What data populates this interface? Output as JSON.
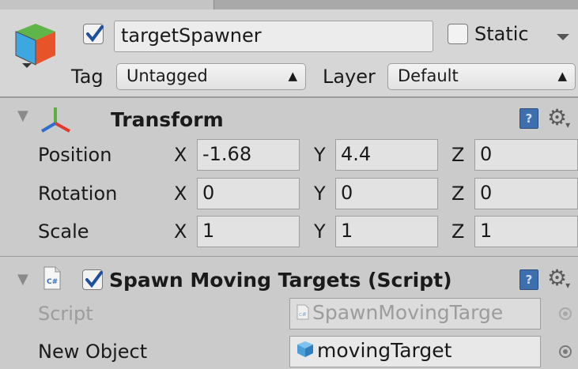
{
  "header": {
    "active": true,
    "object_name": "targetSpawner",
    "static_label": "Static",
    "static_checked": false,
    "tag_label": "Tag",
    "tag_value": "Untagged",
    "layer_label": "Layer",
    "layer_value": "Default"
  },
  "transform": {
    "title": "Transform",
    "rows": [
      {
        "label": "Position",
        "x": "-1.68",
        "y": "4.4",
        "z": "0"
      },
      {
        "label": "Rotation",
        "x": "0",
        "y": "0",
        "z": "0"
      },
      {
        "label": "Scale",
        "x": "1",
        "y": "1",
        "z": "1"
      }
    ],
    "axis_x": "X",
    "axis_y": "Y",
    "axis_z": "Z"
  },
  "script_component": {
    "enabled": true,
    "title": "Spawn Moving Targets (Script)",
    "script_label": "Script",
    "script_value": "SpawnMovingTarge",
    "new_object_label": "New Object",
    "new_object_value": "movingTarget",
    "script_icon_text": "C#"
  },
  "icons": {
    "object": "gameobject-cube-icon",
    "transform": "transform-axes-icon",
    "help": "help-book-icon",
    "settings": "gear-icon",
    "script": "csharp-script-icon"
  },
  "colors": {
    "help_icon": "#3d6fae",
    "prefab_icon": "#4a9fd8",
    "axis_red": "#e23a2a",
    "axis_green": "#5fae3a",
    "axis_blue": "#2f6fd0"
  }
}
